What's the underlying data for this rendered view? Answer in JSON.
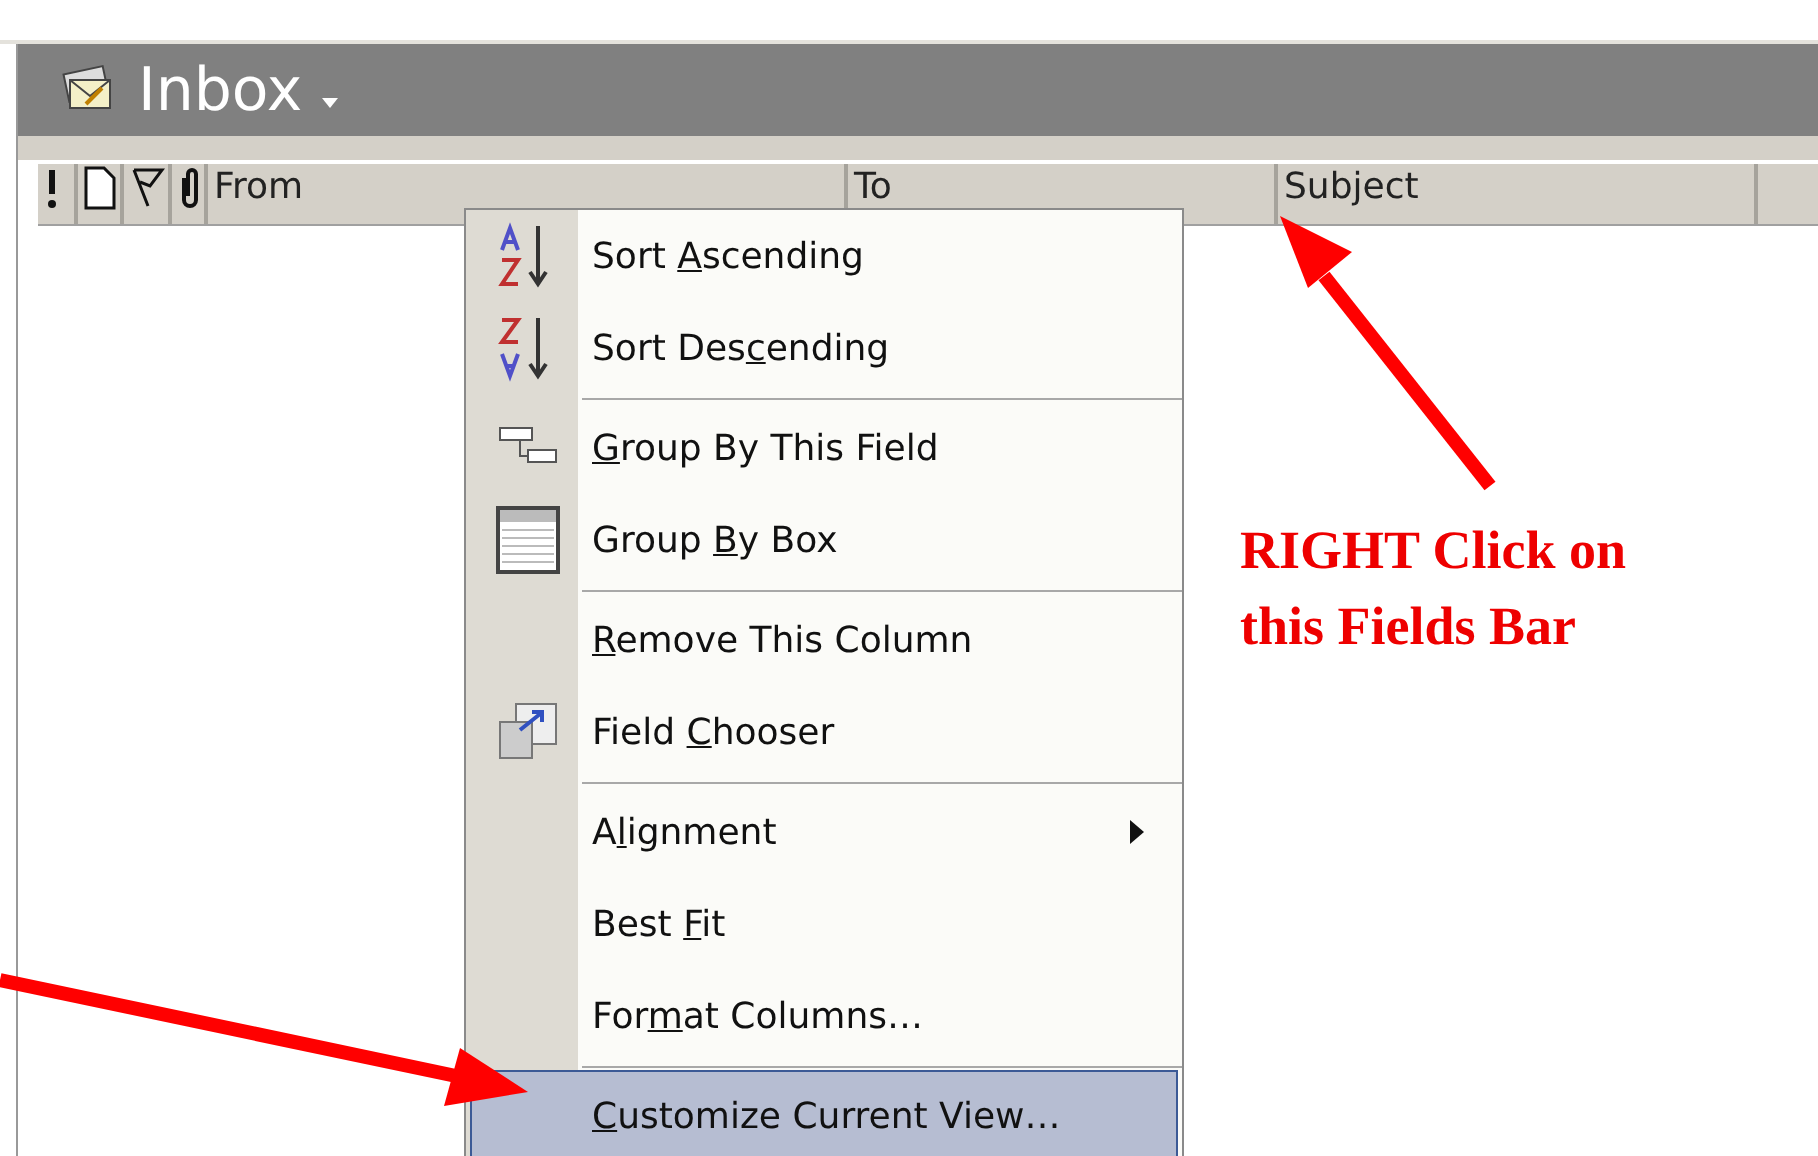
{
  "folder": {
    "title": "Inbox"
  },
  "columns": [
    {
      "kind": "importance"
    },
    {
      "kind": "icon"
    },
    {
      "kind": "flag"
    },
    {
      "kind": "attachment"
    },
    {
      "kind": "text",
      "label": "From"
    },
    {
      "kind": "text",
      "label": "To"
    },
    {
      "kind": "text",
      "label": "Subject"
    }
  ],
  "context_menu": {
    "items": [
      {
        "kind": "command",
        "label": {
          "before": "Sort ",
          "key": "A",
          "after": "scending"
        },
        "selected": false,
        "submenu": false
      },
      {
        "kind": "command",
        "label": {
          "before": "Sort Des",
          "key": "c",
          "after": "ending"
        },
        "selected": false,
        "submenu": false
      },
      {
        "kind": "separator"
      },
      {
        "kind": "command",
        "label": {
          "key": "G",
          "after": "roup By This Field"
        },
        "selected": false,
        "submenu": false
      },
      {
        "kind": "command",
        "label": {
          "before": "Group ",
          "key": "B",
          "after": "y Box"
        },
        "selected": false,
        "submenu": false
      },
      {
        "kind": "separator"
      },
      {
        "kind": "command",
        "label": {
          "key": "R",
          "after": "emove This Column"
        },
        "selected": false,
        "submenu": false
      },
      {
        "kind": "command",
        "label": {
          "before": "Field ",
          "key": "C",
          "after": "hooser"
        },
        "selected": false,
        "submenu": false
      },
      {
        "kind": "separator"
      },
      {
        "kind": "command",
        "label": {
          "before": "A",
          "key": "l",
          "after": "ignment"
        },
        "selected": false,
        "submenu": true
      },
      {
        "kind": "command",
        "label": {
          "before": "Best ",
          "key": "F",
          "after": "it"
        },
        "selected": false,
        "submenu": false
      },
      {
        "kind": "command",
        "label": {
          "before": "For",
          "key": "m",
          "after": "at Columns…"
        },
        "selected": false,
        "submenu": false
      },
      {
        "kind": "separator"
      },
      {
        "kind": "command",
        "label": {
          "key": "C",
          "after": "ustomize Current View…"
        },
        "selected": true,
        "submenu": false
      }
    ]
  },
  "annotation": {
    "text": "RIGHT Click on this Fields Bar"
  }
}
